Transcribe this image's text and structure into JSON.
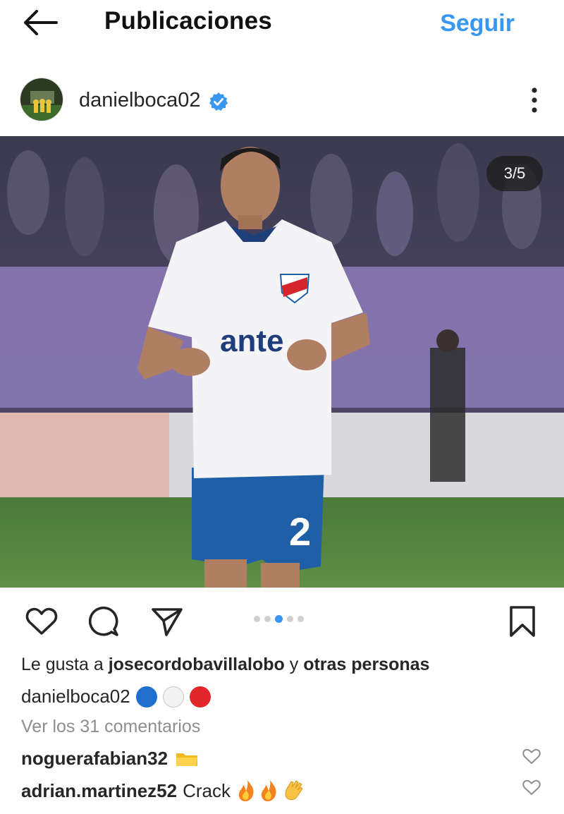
{
  "header": {
    "back_icon": "arrow-left-icon",
    "title": "Publicaciones",
    "follow_label": "Seguir"
  },
  "post": {
    "username": "danielboca02",
    "verified_icon": "verified-badge-icon",
    "more_icon": "more-vertical-icon",
    "carousel_counter": "3/5",
    "carousel_total": 5,
    "carousel_active_index": 3
  },
  "actions": {
    "like_icon": "heart-icon",
    "comment_icon": "comment-icon",
    "share_icon": "send-icon",
    "save_icon": "bookmark-icon"
  },
  "likes": {
    "prefix": "Le gusta a",
    "user": "josecordobavillalobo",
    "joiner": "y",
    "suffix": "otras personas"
  },
  "caption": {
    "username": "danielboca02",
    "emojis": [
      "blue-circle",
      "white-circle",
      "red-circle"
    ]
  },
  "view_comments": "Ver los 31 comentarios",
  "comments": [
    {
      "username": "noguerafabian32",
      "text": "",
      "emoji": "folder-emoji"
    },
    {
      "username": "adrian.martinez52",
      "text": "Crack",
      "emoji": "fire-fire-clap-emoji"
    }
  ],
  "colors": {
    "accent": "#3897f0",
    "text": "#262626",
    "muted": "#8e8e8e",
    "jersey_blue": "#1f5fa8",
    "jersey_red": "#d6262b"
  }
}
